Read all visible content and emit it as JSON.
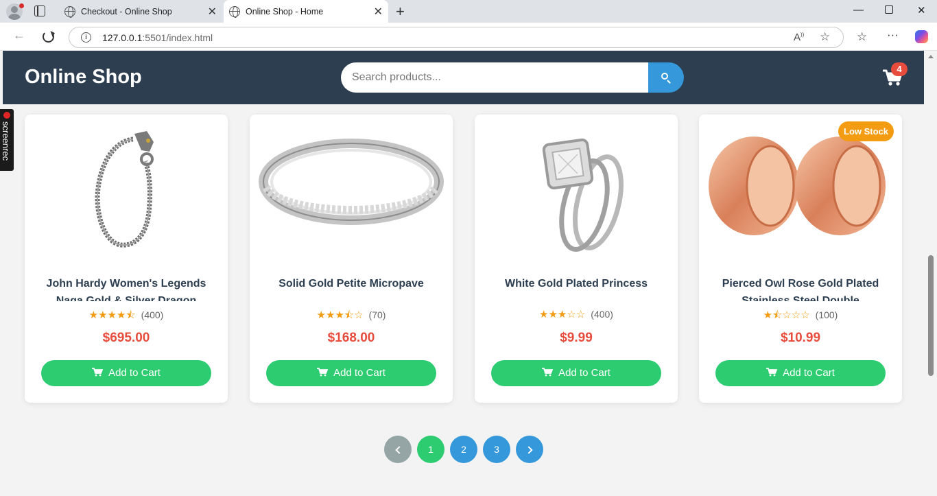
{
  "browser": {
    "tabs": [
      {
        "title": "Checkout - Online Shop",
        "active": false
      },
      {
        "title": "Online Shop - Home",
        "active": true
      }
    ],
    "url_host": "127.0.0.1",
    "url_rest": ":5501/index.html"
  },
  "header": {
    "logo": "Online Shop",
    "search_placeholder": "Search products...",
    "cart_count": "4"
  },
  "overlay": {
    "screenrec_label": "screenrec"
  },
  "products": [
    {
      "name": "John Hardy Women's Legends Naga Gold & Silver Dragon",
      "stars": 4.5,
      "reviews": "(400)",
      "price": "$695.00",
      "badge": "",
      "image": "bracelet"
    },
    {
      "name": "Solid Gold Petite Micropave",
      "stars": 3.5,
      "reviews": "(70)",
      "price": "$168.00",
      "badge": "",
      "image": "ring-band"
    },
    {
      "name": "White Gold Plated Princess",
      "stars": 3,
      "reviews": "(400)",
      "price": "$9.99",
      "badge": "",
      "image": "engagement-ring"
    },
    {
      "name": "Pierced Owl Rose Gold Plated Stainless Steel Double",
      "stars": 1.5,
      "reviews": "(100)",
      "price": "$10.99",
      "badge": "Low Stock",
      "image": "rose-gold-tunnels"
    }
  ],
  "add_to_cart_label": "Add to Cart",
  "pagination": {
    "pages": [
      "1",
      "2",
      "3"
    ],
    "current": "1"
  },
  "colors": {
    "header_bg": "#2c3e50",
    "accent_blue": "#3498db",
    "button_green": "#2ecc71",
    "price_red": "#e74c3c",
    "star_orange": "#f39c12",
    "badge_orange": "#f39c12",
    "disabled_gray": "#95a5a6"
  }
}
